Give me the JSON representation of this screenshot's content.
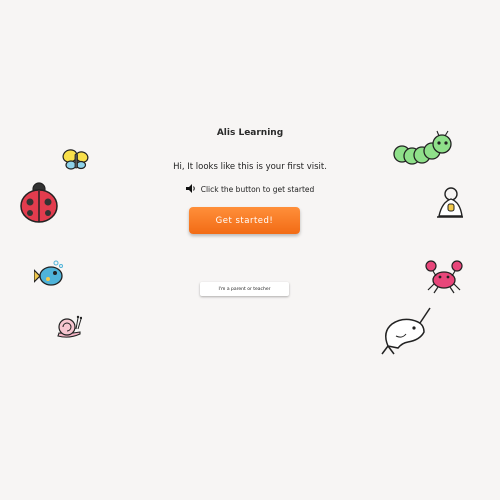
{
  "app": {
    "title": "Alis Learning"
  },
  "welcome": {
    "greeting": "Hi, It looks like this is your first visit.",
    "instruction": "Click the button to get started"
  },
  "buttons": {
    "get_started": "Get started!",
    "parent_teacher": "I'm a parent or teacher"
  },
  "colors": {
    "accent": "#f47a24",
    "background": "#f7f5f4"
  },
  "icons": [
    "speaker-icon",
    "butterfly-icon",
    "ladybug-icon",
    "fish-icon",
    "snail-icon",
    "caterpillar-icon",
    "bell-icon",
    "crab-icon",
    "narwhal-icon"
  ]
}
